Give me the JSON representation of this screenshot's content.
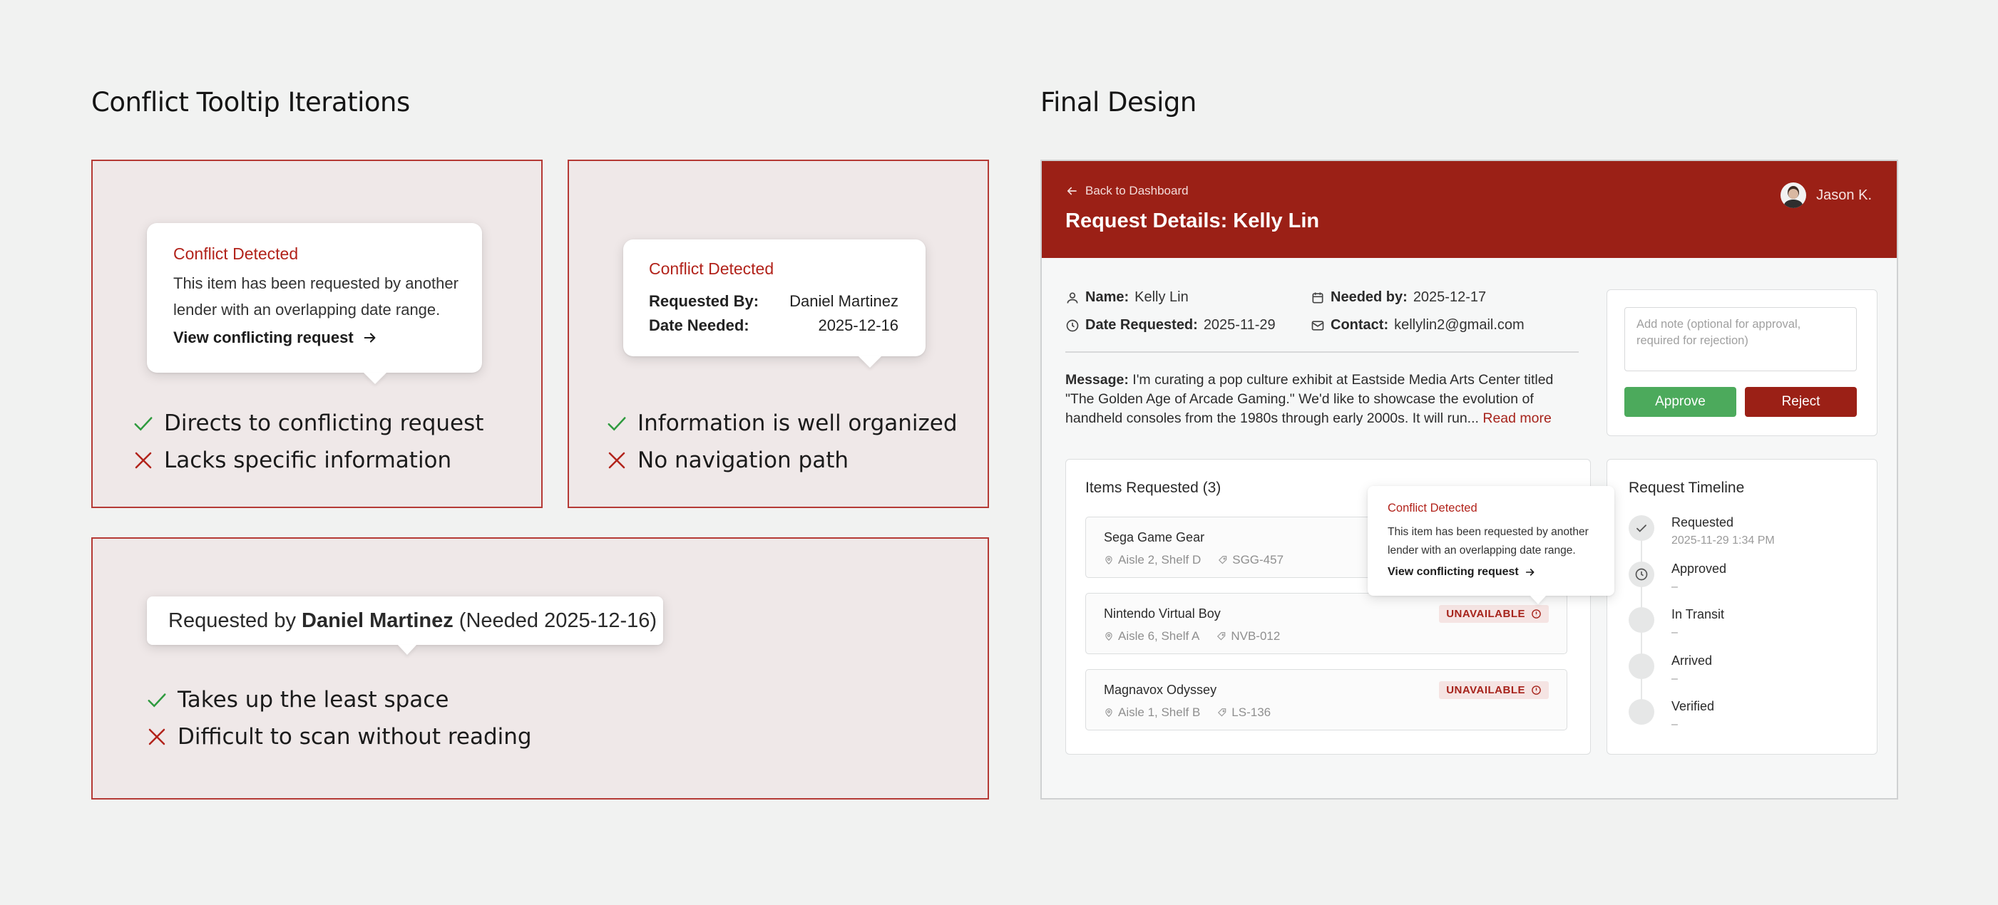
{
  "left_title": "Conflict Tooltip Iterations",
  "right_title": "Final Design",
  "colors": {
    "accent": "#9b2016",
    "check": "#2e9a3e",
    "cross": "#b2231b",
    "approve": "#4caa5c",
    "reject": "#9b2016"
  },
  "iter1": {
    "title": "Conflict Detected",
    "body": "This item has been requested by another lender with an overlapping date range.",
    "link": "View conflicting request",
    "pro": "Directs to conflicting request",
    "con": "Lacks specific information"
  },
  "iter2": {
    "title": "Conflict Detected",
    "requested_by_label": "Requested By:",
    "requested_by_value": "Daniel Martinez",
    "date_needed_label": "Date Needed:",
    "date_needed_value": "2025-12-16",
    "pro": "Information is well organized",
    "con": "No navigation path"
  },
  "iter3": {
    "prefix": "Requested by ",
    "name": "Daniel Martinez",
    "suffix": " (Needed 2025-12-16)",
    "pro": "Takes up the least space",
    "con": "Difficult to scan without reading"
  },
  "final": {
    "back_link": "Back to Dashboard",
    "page_title": "Request Details: Kelly Lin",
    "user_name": "Jason K.",
    "name_label": "Name:",
    "name_value": "Kelly Lin",
    "needed_label": "Needed by:",
    "needed_value": "2025-12-17",
    "date_req_label": "Date Requested:",
    "date_req_value": "2025-11-29",
    "contact_label": "Contact:",
    "contact_value": "kellylin2@gmail.com",
    "message_label": "Message:",
    "message_line1": " I'm curating a pop culture exhibit at Eastside Media Arts Center titled",
    "message_line2": "\"The Golden Age of Arcade Gaming.\" We'd like to showcase the evolution of",
    "message_line3": "handheld consoles from the 1980s through early 2000s. It will run...",
    "read_more": "Read more",
    "note_placeholder": "Add note (optional for approval, required for rejection)",
    "approve": "Approve",
    "reject": "Reject",
    "items_title": "Items Requested (3)",
    "items": [
      {
        "name": "Sega Game Gear",
        "location": "Aisle 2, Shelf D",
        "sku": "SGG-457"
      },
      {
        "name": "Nintendo Virtual Boy",
        "location": "Aisle 6, Shelf A",
        "sku": "NVB-012",
        "status": "UNAVAILABLE"
      },
      {
        "name": "Magnavox Odyssey",
        "location": "Aisle 1, Shelf B",
        "sku": "LS-136",
        "status": "UNAVAILABLE"
      }
    ],
    "tooltip_title": "Conflict Detected",
    "tooltip_body_line1": "This item has been requested by another",
    "tooltip_body_line2": "lender with an overlapping date range.",
    "tooltip_link": "View conflicting request",
    "timeline_title": "Request Timeline",
    "timeline": [
      {
        "label": "Requested",
        "sub": "2025-11-29 1:34 PM",
        "icon": "check-icon"
      },
      {
        "label": "Approved",
        "sub": "–",
        "icon": "clock-icon"
      },
      {
        "label": "In Transit",
        "sub": "–"
      },
      {
        "label": "Arrived",
        "sub": "–"
      },
      {
        "label": "Verified",
        "sub": "–"
      }
    ]
  }
}
